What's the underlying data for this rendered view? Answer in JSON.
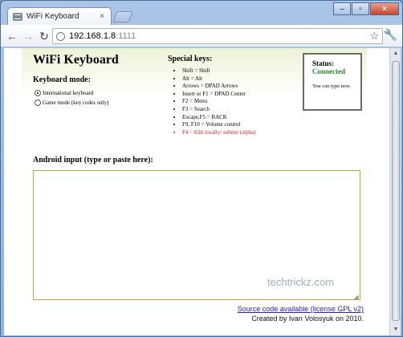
{
  "browser": {
    "tab_title": "WiFi Keyboard",
    "tab_close": "×",
    "url_host": "192.168.1.8",
    "url_port": ":1111",
    "back": "←",
    "forward": "→",
    "reload": "↻",
    "star": "☆",
    "wrench": "🔧",
    "minimize": "–",
    "maximize": "▫",
    "close": "×"
  },
  "page": {
    "title": "WiFi Keyboard",
    "keyboard_mode_label": "Keyboard mode:",
    "modes": [
      {
        "label": "International keyboard",
        "selected": true
      },
      {
        "label": "Game mode (key codes only)",
        "selected": false
      }
    ],
    "special_keys_title": "Special keys:",
    "special_keys": [
      "Shift = Shift",
      "Alt = Alt",
      "Arrows = DPAD Arrows",
      "Insert or F1 = DPAD Center",
      "F2 = Menu",
      "F3 = Search",
      "Escape,F5 = BACK",
      "F9, F10 = Volume control"
    ],
    "special_key_highlight": "F4 = Edit locally/ submit (alpha)",
    "status_label": "Status:",
    "status_value": "Connected",
    "status_note": "You can type now.",
    "input_label": "Android input (type or paste here):",
    "input_value": "",
    "watermark": "techtrickz.com",
    "source_link": "Source code available (license GPL v2)",
    "credit": "Created by Ivan Volosyuk on 2010."
  },
  "colors": {
    "status_connected": "#2a8a2a",
    "highlight_key": "#e02020",
    "link": "#2222cc",
    "input_border": "#c8a040"
  }
}
